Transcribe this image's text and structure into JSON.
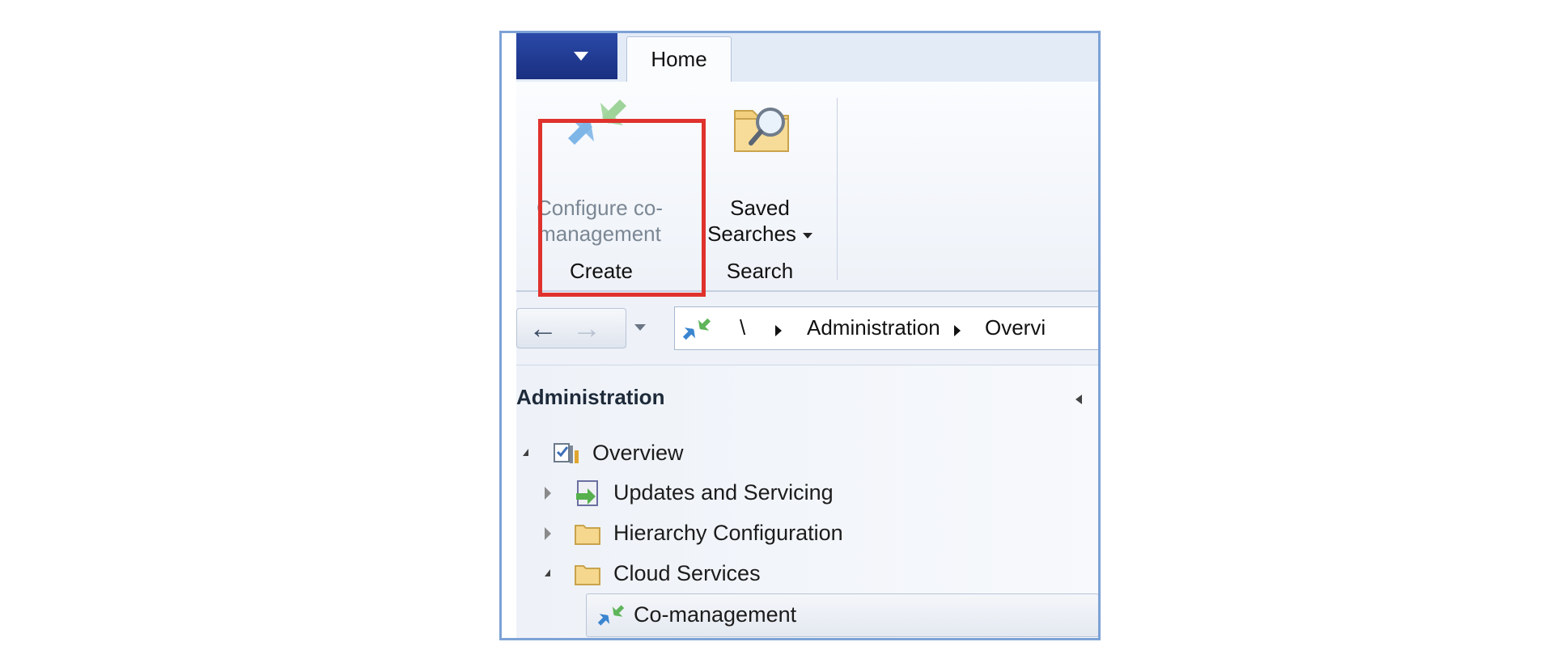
{
  "ribbon": {
    "tab_home": "Home",
    "groups": [
      {
        "name": "Create",
        "button_line1": "Configure co-",
        "button_line2": "management"
      },
      {
        "name": "Search",
        "button_line1": "Saved",
        "button_line2": "Searches"
      }
    ]
  },
  "address_bar": {
    "root": "\\",
    "crumbs": [
      "Administration",
      "Overvi"
    ]
  },
  "nav_pane": {
    "title": "Administration",
    "tree": [
      {
        "label": "Overview",
        "expanded": true,
        "icon": "overview-icon"
      },
      {
        "label": "Updates and Servicing",
        "expanded": false,
        "icon": "updates-icon"
      },
      {
        "label": "Hierarchy Configuration",
        "expanded": false,
        "icon": "folder-icon"
      },
      {
        "label": "Cloud Services",
        "expanded": true,
        "icon": "folder-icon"
      },
      {
        "label": "Co-management",
        "selected": true,
        "icon": "co-management-icon"
      }
    ]
  },
  "colors": {
    "highlight_box": "#e0322d",
    "frame_border": "#7da2d6",
    "app_menu": "#1f3a93"
  }
}
